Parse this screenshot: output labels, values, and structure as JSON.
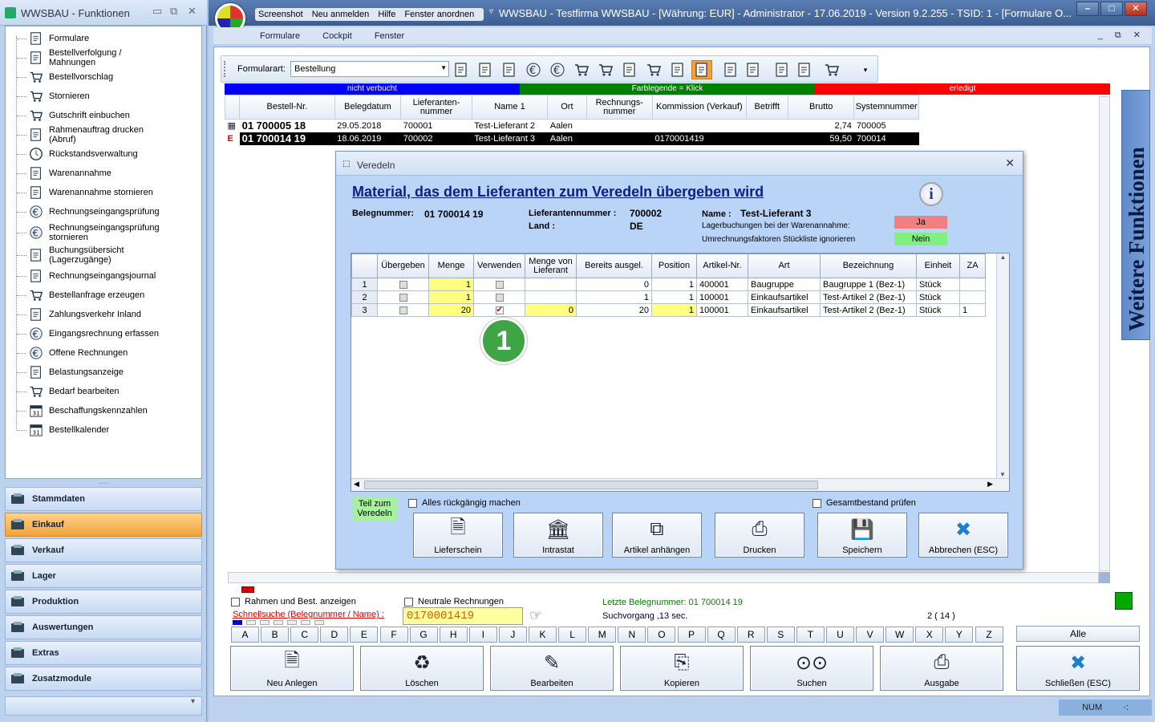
{
  "left": {
    "title": "WWSBAU - Funktionen",
    "tree": [
      {
        "label": "Formulare",
        "icon": "document-icon"
      },
      {
        "label": "Bestellverfolgung / Mahnungen",
        "icon": "map-icon"
      },
      {
        "label": "Bestellvorschlag",
        "icon": "cart-icon"
      },
      {
        "label": "Stornieren",
        "icon": "cart-cancel-icon"
      },
      {
        "label": "Gutschrift einbuchen",
        "icon": "cart-credit-icon"
      },
      {
        "label": "Rahmenauftrag drucken (Abruf)",
        "icon": "print-document-icon"
      },
      {
        "label": "Rückstandsverwaltung",
        "icon": "clock-icon"
      },
      {
        "label": "Warenannahme",
        "icon": "handtruck-icon"
      },
      {
        "label": "Warenannahme stornieren",
        "icon": "handtruck-cancel-icon"
      },
      {
        "label": "Rechnungseingangsprüfung",
        "icon": "euro-icon"
      },
      {
        "label": "Rechnungseingangsprüfung stornieren",
        "icon": "euro-cancel-icon"
      },
      {
        "label": "Buchungsübersicht (Lagerzugänge)",
        "icon": "list-icon"
      },
      {
        "label": "Rechnungseingangsjournal",
        "icon": "journal-icon"
      },
      {
        "label": "Bestellanfrage erzeugen",
        "icon": "cart-request-icon"
      },
      {
        "label": "Zahlungsverkehr Inland",
        "icon": "money-icon"
      },
      {
        "label": "Eingangsrechnung erfassen",
        "icon": "euro-invoice-icon"
      },
      {
        "label": "Offene Rechnungen",
        "icon": "euro-open-icon"
      },
      {
        "label": "Belastungsanzeige",
        "icon": "weight-icon"
      },
      {
        "label": "Bedarf bearbeiten",
        "icon": "basket-icon"
      },
      {
        "label": "Beschaffungskennzahlen",
        "icon": "calendar-chart-icon"
      },
      {
        "label": "Bestellkalender",
        "icon": "calendar-icon"
      }
    ],
    "nav": [
      {
        "label": "Stammdaten",
        "icon": "stammdaten-icon",
        "active": false
      },
      {
        "label": "Einkauf",
        "icon": "cart-icon",
        "active": true
      },
      {
        "label": "Verkauf",
        "icon": "register-icon",
        "active": false
      },
      {
        "label": "Lager",
        "icon": "warehouse-icon",
        "active": false
      },
      {
        "label": "Produktion",
        "icon": "production-icon",
        "active": false
      },
      {
        "label": "Auswertungen",
        "icon": "analysis-icon",
        "active": false
      },
      {
        "label": "Extras",
        "icon": "extras-icon",
        "active": false
      },
      {
        "label": "Zusatzmodule",
        "icon": "modules-icon",
        "active": false
      }
    ],
    "splitter": "·····"
  },
  "main": {
    "menu1": [
      "Screenshot",
      "Neu anmelden",
      "Hilfe",
      "Fenster anordnen"
    ],
    "title": "WWSBAU - Testfirma WWSBAU - [Währung: EUR] - Administrator - 17.06.2019 - Version 9.2.255 - TSID: 1 - [Formulare O...",
    "menu2": [
      "Formulare",
      "Cockpit",
      "Fenster"
    ],
    "formart_label": "Formularart:",
    "formart_value": "Bestellung",
    "legend": [
      "nicht verbucht",
      "Farblegende = Klick",
      "erledigt"
    ],
    "colors": {
      "blue": "#0000ff",
      "green": "#008000",
      "red": "#ff0000",
      "yellow": "#ffff80"
    },
    "table": {
      "headers": [
        "Bestell-Nr.",
        "Belegdatum",
        "Lieferanten-nummer",
        "Name 1",
        "Ort",
        "Rechnungs-nummer",
        "Kommission (Verkauf)",
        "Betrifft",
        "Brutto",
        "Systemnummer"
      ],
      "rows": [
        {
          "mark": "▦",
          "nr": "01 700005 18",
          "datum": "29.05.2018",
          "lnr": "700001",
          "name": "Test-Lieferant 2",
          "ort": "Aalen",
          "rnr": "",
          "kom": "",
          "betr": "",
          "brutto": "2,74",
          "sys": "700005"
        },
        {
          "mark": "E",
          "nr": "01 700014 19",
          "datum": "18.06.2019",
          "lnr": "700002",
          "name": "Test-Lieferant 3",
          "ort": "Aalen",
          "rnr": "",
          "kom": "0170001419",
          "betr": "",
          "brutto": "59,50",
          "sys": "700014"
        }
      ]
    },
    "sidebar_right": "Weitere Funktionen",
    "bottom": {
      "rahmen": "Rahmen und Best. anzeigen",
      "neutrale": "Neutrale Rechnungen",
      "schnell_label": "Schnellsuche (Belegnummer / Name) :",
      "schnell_value": "0170001419",
      "letzte": "Letzte Belegnummer: 01 700014 19",
      "such": "Suchvorgang ,13 sec.",
      "count": "2  ( 14 )",
      "alle": "Alle",
      "letters": [
        "A",
        "B",
        "C",
        "D",
        "E",
        "F",
        "G",
        "H",
        "I",
        "J",
        "K",
        "L",
        "M",
        "N",
        "O",
        "P",
        "Q",
        "R",
        "S",
        "T",
        "U",
        "V",
        "W",
        "X",
        "Y",
        "Z"
      ],
      "buttons": [
        {
          "label": "Neu Anlegen",
          "icon": "new-document-icon"
        },
        {
          "label": "Löschen",
          "icon": "recycle-bin-icon"
        },
        {
          "label": "Bearbeiten",
          "icon": "edit-icon"
        },
        {
          "label": "Kopieren",
          "icon": "copy-icon"
        },
        {
          "label": "Suchen",
          "icon": "binoculars-icon"
        },
        {
          "label": "Ausgabe",
          "icon": "printer-icon"
        },
        {
          "label": "Schließen (ESC)",
          "icon": "close-x-icon"
        }
      ],
      "num": "NUM"
    }
  },
  "dialog": {
    "title": "Veredeln",
    "heading": "Material, das dem Lieferanten zum Veredeln übergeben wird",
    "belegnummer_label": "Belegnummer:",
    "belegnummer": "01 700014 19",
    "lieferant_label": "Lieferantennummer :",
    "lieferant": "700002",
    "land_label": "Land :",
    "land": "DE",
    "name_label": "Name :",
    "name": "Test-Lieferant 3",
    "lager_label": "Lagerbuchungen bei der Warenannahme:",
    "lager_value": "Ja",
    "umr_label": "Umrechnungsfaktoren Stückliste ignorieren",
    "umr_value": "Nein",
    "grid_headers": [
      "",
      "Übergeben",
      "Menge",
      "Verwenden",
      "Menge von Lieferant",
      "Bereits ausgel.",
      "Position",
      "Artikel-Nr.",
      "Art",
      "Bezeichnung",
      "Einheit",
      "ZA"
    ],
    "grid_rows": [
      {
        "n": "1",
        "menge": "1",
        "verw": false,
        "mvl": "",
        "bereits": "0",
        "pos": "1",
        "art_nr": "400001",
        "art": "Baugruppe",
        "bez": "Baugruppe 1  (Bez-1)",
        "einheit": "Stück",
        "za": ""
      },
      {
        "n": "2",
        "menge": "1",
        "verw": false,
        "mvl": "",
        "bereits": "1",
        "pos": "1",
        "art_nr": "100001",
        "art": "Einkaufsartikel",
        "bez": "Test-Artikel 2  (Bez-1)",
        "einheit": "Stück",
        "za": ""
      },
      {
        "n": "3",
        "menge": "20",
        "verw": true,
        "mvl": "0",
        "bereits": "20",
        "pos": "1",
        "art_nr": "100001",
        "art": "Einkaufsartikel",
        "bez": "Test-Artikel 2  (Bez-1)",
        "einheit": "Stück",
        "za": "1"
      }
    ],
    "badge": "1",
    "teil": "Teil zum Veredeln",
    "alles": "Alles rückgängig machen",
    "gesamt": "Gesamtbestand prüfen",
    "buttons": [
      {
        "label": "Lieferschein",
        "icon": "delivery-note-icon"
      },
      {
        "label": "Intrastat",
        "icon": "intrastat-icon"
      },
      {
        "label": "Artikel anhängen",
        "icon": "attach-article-icon"
      },
      {
        "label": "Drucken",
        "icon": "printer-icon"
      },
      {
        "label": "Speichern",
        "icon": "save-icon"
      },
      {
        "label": "Abbrechen (ESC)",
        "icon": "cancel-x-icon"
      }
    ]
  }
}
